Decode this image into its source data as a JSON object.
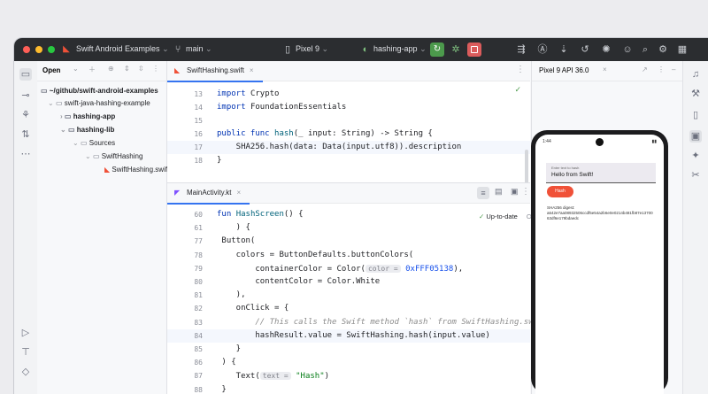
{
  "titlebar": {
    "project": "Swift Android Examples",
    "branch": "main",
    "device": "Pixel 9",
    "run_config": "hashing-app"
  },
  "project_panel": {
    "header": "Open",
    "tree": [
      "~/github/swift-android-examples",
      "swift-java-hashing-example",
      "hashing-app",
      "hashing-lib",
      "Sources",
      "SwiftHashing",
      "SwiftHashing.swift"
    ]
  },
  "editor_top": {
    "tab": "SwiftHashing.swift",
    "lines": [
      {
        "n": "13",
        "code": [
          {
            "t": "import ",
            "c": "kw"
          },
          {
            "t": "Crypto",
            "c": ""
          }
        ]
      },
      {
        "n": "14",
        "code": [
          {
            "t": "import ",
            "c": "kw"
          },
          {
            "t": "FoundationEssentials",
            "c": ""
          }
        ]
      },
      {
        "n": "15",
        "code": []
      },
      {
        "n": "16",
        "code": [
          {
            "t": "public func ",
            "c": "kw"
          },
          {
            "t": "hash",
            "c": "fn"
          },
          {
            "t": "(_ input: String) -> String {",
            "c": ""
          }
        ]
      },
      {
        "n": "17",
        "code": [
          {
            "t": "    SHA256.hash(data: Data(input.utf8)).description",
            "c": ""
          }
        ],
        "hl": true
      },
      {
        "n": "18",
        "code": [
          {
            "t": "}",
            "c": ""
          }
        ]
      }
    ]
  },
  "editor_bottom": {
    "tab": "MainActivity.kt",
    "status": "Up-to-date",
    "status_off": "OFF",
    "lines": [
      {
        "n": "60",
        "code": [
          {
            "t": "fun ",
            "c": "kw"
          },
          {
            "t": "HashScreen",
            "c": "fn"
          },
          {
            "t": "() {",
            "c": ""
          }
        ]
      },
      {
        "n": "61",
        "code": [
          {
            "t": "    ) {",
            "c": ""
          }
        ]
      },
      {
        "n": "77",
        "code": [
          {
            "t": " Button(",
            "c": ""
          }
        ]
      },
      {
        "n": "78",
        "code": [
          {
            "t": "    colors = ButtonDefaults.buttonColors(",
            "c": ""
          }
        ]
      },
      {
        "n": "79",
        "code": [
          {
            "t": "        containerColor = Color(",
            "c": ""
          },
          {
            "t": "color =",
            "c": "hint"
          },
          {
            "t": " ",
            "c": ""
          },
          {
            "t": "0xFFF05138",
            "c": "num"
          },
          {
            "t": "),",
            "c": ""
          }
        ]
      },
      {
        "n": "80",
        "code": [
          {
            "t": "        contentColor = Color.White",
            "c": ""
          }
        ]
      },
      {
        "n": "81",
        "code": [
          {
            "t": "    ),",
            "c": ""
          }
        ]
      },
      {
        "n": "82",
        "code": [
          {
            "t": "    onClick = {",
            "c": ""
          }
        ]
      },
      {
        "n": "83",
        "code": [
          {
            "t": "        // This calls the Swift method `hash` from SwiftHashing.swift",
            "c": "cm"
          }
        ]
      },
      {
        "n": "84",
        "code": [
          {
            "t": "        hashResult.value = SwiftHashing.hash(input.value)",
            "c": ""
          }
        ],
        "hl": true
      },
      {
        "n": "85",
        "code": [
          {
            "t": "    }",
            "c": ""
          }
        ]
      },
      {
        "n": "86",
        "code": [
          {
            "t": " ) {",
            "c": ""
          }
        ]
      },
      {
        "n": "87",
        "code": [
          {
            "t": "    Text(",
            "c": ""
          },
          {
            "t": "text =",
            "c": "hint"
          },
          {
            "t": " ",
            "c": ""
          },
          {
            "t": "\"Hash\"",
            "c": "str"
          },
          {
            "t": ")",
            "c": ""
          }
        ]
      },
      {
        "n": "88",
        "code": [
          {
            "t": " }",
            "c": ""
          }
        ]
      }
    ]
  },
  "device_panel": {
    "title": "Pixel 9 API 36.0"
  },
  "phone": {
    "time": "1:44",
    "input_label": "Enter text to hash",
    "input_value": "Hello from Swift!",
    "button_label": "Hash",
    "result_label": "SHA256 digest:",
    "result_value": "a642e7aa08932506ccdf5e54a2b6e0e0214b481fb87e1370063df6e179bdaedc"
  },
  "colors": {
    "accent": "#3574f0",
    "run_green": "#4c9a4c",
    "stop_red": "#db5c5c",
    "swift_orange": "#f05138"
  }
}
